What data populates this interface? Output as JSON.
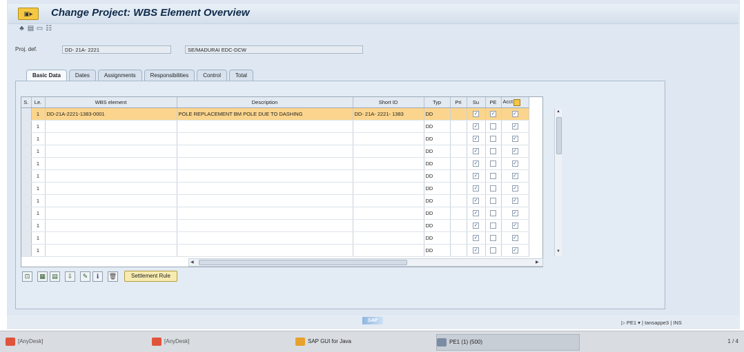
{
  "window": {
    "title": "Change Project: WBS Element Overview"
  },
  "toolbar": {
    "icons": [
      "hierarchy-icon",
      "structure-icon",
      "document-icon",
      "settings-icon"
    ]
  },
  "header": {
    "proj_def_label": "Proj. def.",
    "proj_def_value": "DD- 21A- 2221",
    "proj_desc_value": "SE/MADURAI EDC-DCW"
  },
  "tabs": [
    "Basic Data",
    "Dates",
    "Assignments",
    "Responsibilities",
    "Control",
    "Total"
  ],
  "table": {
    "columns": [
      "S.",
      "Le.",
      "WBS element",
      "Description",
      "Short ID",
      "Typ",
      "Pri",
      "Su",
      "PE",
      "Acct"
    ],
    "rows": [
      {
        "level": "1",
        "wbs": "DD-21A-2221-1383-0001",
        "description": "POLE REPLACEMENT BM POLE DUE TO DASHING",
        "short_id": "DD- 21A- 2221- 1383",
        "typ": "DD",
        "su": true,
        "pe": true,
        "acct": true,
        "highlighted": true
      },
      {
        "level": "1",
        "wbs": "",
        "description": "",
        "short_id": "",
        "typ": "DD",
        "su": true,
        "pe": false,
        "acct": true
      },
      {
        "level": "1",
        "wbs": "",
        "description": "",
        "short_id": "",
        "typ": "DD",
        "su": true,
        "pe": false,
        "acct": true
      },
      {
        "level": "1",
        "wbs": "",
        "description": "",
        "short_id": "",
        "typ": "DD",
        "su": true,
        "pe": false,
        "acct": true
      },
      {
        "level": "1",
        "wbs": "",
        "description": "",
        "short_id": "",
        "typ": "DD",
        "su": true,
        "pe": false,
        "acct": true
      },
      {
        "level": "1",
        "wbs": "",
        "description": "",
        "short_id": "",
        "typ": "DD",
        "su": true,
        "pe": false,
        "acct": true
      },
      {
        "level": "1",
        "wbs": "",
        "description": "",
        "short_id": "",
        "typ": "DD",
        "su": true,
        "pe": false,
        "acct": true
      },
      {
        "level": "1",
        "wbs": "",
        "description": "",
        "short_id": "",
        "typ": "DD",
        "su": true,
        "pe": false,
        "acct": true
      },
      {
        "level": "1",
        "wbs": "",
        "description": "",
        "short_id": "",
        "typ": "DD",
        "su": true,
        "pe": false,
        "acct": true
      },
      {
        "level": "1",
        "wbs": "",
        "description": "",
        "short_id": "",
        "typ": "DD",
        "su": true,
        "pe": false,
        "acct": true
      },
      {
        "level": "1",
        "wbs": "",
        "description": "",
        "short_id": "",
        "typ": "DD",
        "su": true,
        "pe": false,
        "acct": true
      },
      {
        "level": "1",
        "wbs": "",
        "description": "",
        "short_id": "",
        "typ": "DD",
        "su": true,
        "pe": false,
        "acct": true
      }
    ]
  },
  "buttons": {
    "settlement_rule": "Settlement Rule"
  },
  "status": {
    "system": "PE1",
    "user": "tansappe3",
    "mode": "INS",
    "logo": "SAP"
  },
  "taskbar": {
    "items": [
      {
        "label": "[AnyDesk]",
        "color": "#e0543b"
      },
      {
        "label": "[AnyDesk]",
        "color": "#e0543b"
      },
      {
        "label": "SAP GUI for Java",
        "color": "#e8a12c"
      },
      {
        "label": "PE1 (1) (500)",
        "color": "#7a8ca3"
      }
    ],
    "pager": "1 / 4"
  }
}
